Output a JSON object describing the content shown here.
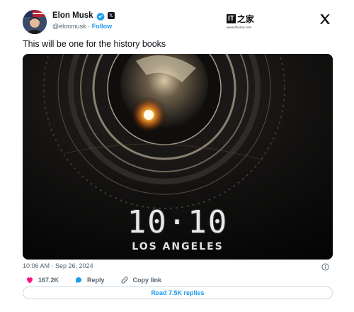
{
  "colors": {
    "accent": "#1d9bf0",
    "like": "#f91880",
    "text": "#0f1419",
    "muted": "#536471"
  },
  "author": {
    "name": "Elon Musk",
    "handle": "@elonmusk",
    "separator": "·",
    "follow_label": "Follow",
    "verified_icon": "verified-badge-icon",
    "affiliation_icon": "x-affiliation-icon"
  },
  "watermark": {
    "brand": "IT",
    "brand_cn": "之家",
    "url": "www.ithome.com"
  },
  "tweet": {
    "text": "This will be one for the history books",
    "timestamp": "10:06 AM · Sep 26, 2024"
  },
  "media": {
    "event_date": "10·10",
    "event_place": "LOS ANGELES"
  },
  "actions": {
    "likes": "167.2K",
    "reply_label": "Reply",
    "copy_link_label": "Copy link",
    "read_replies_label": "Read 7.5K replies"
  }
}
